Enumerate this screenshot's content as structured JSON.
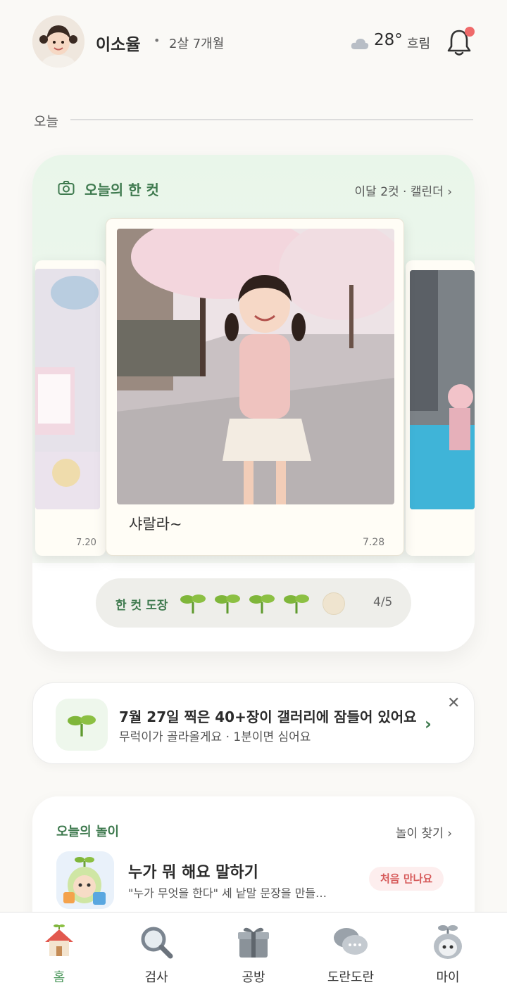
{
  "header": {
    "child_name": "이소율",
    "separator": "•",
    "child_age": "2살 7개월",
    "temperature": "28°",
    "weather": "흐림",
    "weather_icon": "cloud-icon",
    "notification_icon": "bell-icon",
    "has_notification": true
  },
  "section": {
    "label": "오늘"
  },
  "today_card": {
    "title": "오늘의 한 컷",
    "link": "이달 2컷 · 캘린더 ›",
    "photos": [
      {
        "date": "7.20"
      },
      {
        "caption": "샤랄라~",
        "date": "7.28"
      },
      {
        "date": ""
      }
    ],
    "stamp": {
      "label": "한 컷 도장",
      "filled": 4,
      "total": 5,
      "count_text": "4/5"
    }
  },
  "banner": {
    "title": "7월 27일 찍은 40+장이 갤러리에 잠들어 있어요",
    "subtitle": "무럭이가 골라올게요 · 1분이면 심어요",
    "close": "✕",
    "chevron": "›"
  },
  "play": {
    "title": "오늘의 놀이",
    "link": "놀이 찾기 ›",
    "item_name": "누가 뭐 해요 말하기",
    "item_desc": "\"누가 무엇을 한다\" 세 낱말 문장을 만들…",
    "badge": "처음 만나요"
  },
  "nav": {
    "items": [
      {
        "label": "홈",
        "icon": "house-icon",
        "active": true
      },
      {
        "label": "검사",
        "icon": "magnifier-icon",
        "active": false
      },
      {
        "label": "공방",
        "icon": "gift-box-icon",
        "active": false
      },
      {
        "label": "도란도란",
        "icon": "chat-bubbles-icon",
        "active": false
      },
      {
        "label": "마이",
        "icon": "sprout-mascot-icon",
        "active": false
      }
    ]
  },
  "colors": {
    "accent_green": "#3f7a4f",
    "badge_red": "#d65a5a",
    "notification_dot": "#ef6a6a"
  }
}
